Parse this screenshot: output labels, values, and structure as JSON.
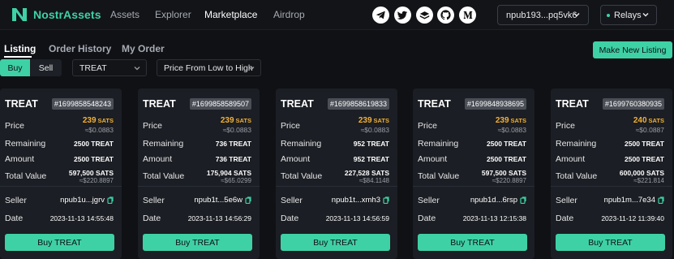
{
  "brand": {
    "name": "NostrAssets",
    "accent": "#3ed1a6"
  },
  "nav": {
    "assets": "Assets",
    "explorer": "Explorer",
    "marketplace": "Marketplace",
    "airdrop": "Airdrop"
  },
  "socials": [
    "telegram-icon",
    "twitter-icon",
    "book-stack-icon",
    "github-icon",
    "medium-icon"
  ],
  "wallet": {
    "label": "npub193...pq5vk6"
  },
  "relays": {
    "label": "Relays"
  },
  "tabs": {
    "listing": "Listing",
    "order_history": "Order History",
    "my_order": "My Order"
  },
  "new_listing": "Make New Listing",
  "filters": {
    "buy": "Buy",
    "sell": "Sell",
    "token": "TREAT",
    "sort": "Price From Low to High"
  },
  "labels": {
    "price": "Price",
    "remaining": "Remaining",
    "amount": "Amount",
    "total_value": "Total Value",
    "seller": "Seller",
    "date": "Date",
    "sats_unit": "SATS"
  },
  "cards": [
    {
      "title": "TREAT",
      "id": "#1699858548243",
      "price_sats": "239",
      "price_usd": "≈$0.0883",
      "remaining": "2500 TREAT",
      "amount": "2500 TREAT",
      "tv_sats": "597,500 SATS",
      "tv_usd": "≈$220.8897",
      "seller": "npub1u...jgrv",
      "date": "2023-11-13 14:55:48",
      "buy": "Buy TREAT"
    },
    {
      "title": "TREAT",
      "id": "#1699858589507",
      "price_sats": "239",
      "price_usd": "≈$0.0883",
      "remaining": "736 TREAT",
      "amount": "736 TREAT",
      "tv_sats": "175,904 SATS",
      "tv_usd": "≈$65.0299",
      "seller": "npub1t...5e6w",
      "date": "2023-11-13 14:56:29",
      "buy": "Buy TREAT"
    },
    {
      "title": "TREAT",
      "id": "#1699858619833",
      "price_sats": "239",
      "price_usd": "≈$0.0883",
      "remaining": "952 TREAT",
      "amount": "952 TREAT",
      "tv_sats": "227,528 SATS",
      "tv_usd": "≈$84.1148",
      "seller": "npub1t...xmh3",
      "date": "2023-11-13 14:56:59",
      "buy": "Buy TREAT"
    },
    {
      "title": "TREAT",
      "id": "#1699848938695",
      "price_sats": "239",
      "price_usd": "≈$0.0883",
      "remaining": "2500 TREAT",
      "amount": "2500 TREAT",
      "tv_sats": "597,500 SATS",
      "tv_usd": "≈$220.8897",
      "seller": "npub1d...6rsp",
      "date": "2023-11-13 12:15:38",
      "buy": "Buy TREAT"
    },
    {
      "title": "TREAT",
      "id": "#1699760380935",
      "price_sats": "240",
      "price_usd": "≈$0.0887",
      "remaining": "2500 TREAT",
      "amount": "2500 TREAT",
      "tv_sats": "600,000 SATS",
      "tv_usd": "≈$221.814",
      "seller": "npub1m...7e34",
      "date": "2023-11-12 11:39:40",
      "buy": "Buy TREAT"
    }
  ]
}
